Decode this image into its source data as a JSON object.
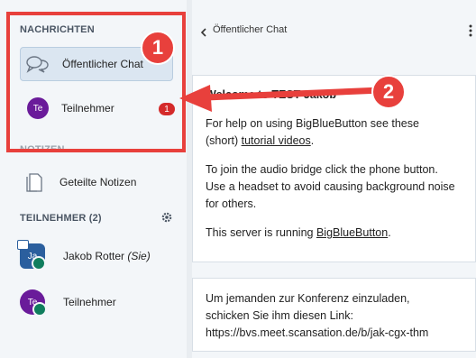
{
  "sidebar": {
    "messages_heading": "NACHRICHTEN",
    "public_chat_label": "Öffentlicher Chat",
    "participant_chat": {
      "initials": "Te",
      "name": "Teilnehmer",
      "badge": "1"
    },
    "notes_heading_fragment": "NOTIZEN",
    "shared_notes_label": "Geteilte Notizen",
    "participants_heading": "TEILNEHMER (2)",
    "users": [
      {
        "initials": "Ja",
        "name": "Jakob Rotter",
        "suffix": "(Sie)",
        "color": "#2b5f9e"
      },
      {
        "initials": "Te",
        "name": "Teilnehmer",
        "suffix": "",
        "color": "#6a1b9a"
      }
    ]
  },
  "chat": {
    "back_label": "Öffentlicher Chat",
    "welcome_start": "Welcome to ",
    "welcome_bold": "TEST Jakob",
    "help_text_1": "For help on using BigBlueButton see these",
    "help_text_2": "(short) ",
    "help_link": "tutorial videos",
    "help_text_3": ".",
    "audio_1": "To join the audio bridge click the phone button.",
    "audio_2": "Use a headset to avoid causing background noise",
    "audio_3": "for others.",
    "server_text": "This server is running ",
    "server_link": "BigBlueButton",
    "server_end": ".",
    "invite_1": "Um jemanden zur Konferenz einzuladen,",
    "invite_2": "schicken Sie ihm diesen Link:",
    "invite_url": "https://bvs.meet.scansation.de/b/jak-cgx-thm"
  },
  "annotations": {
    "marker_1": "1",
    "marker_2": "2"
  },
  "colors": {
    "accent_red": "#e8403c",
    "avatar_purple": "#6a1b9a",
    "avatar_blue": "#2b5f9e",
    "badge_red": "#d42a2a"
  }
}
